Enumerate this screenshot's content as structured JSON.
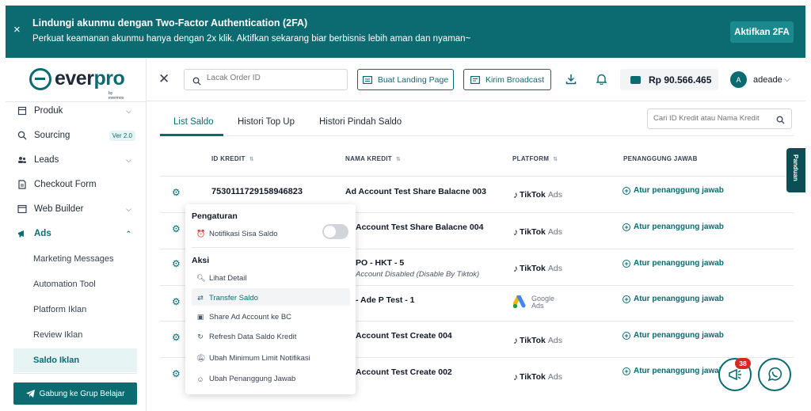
{
  "banner": {
    "title": "Lindungi akunmu dengan Two-Factor Authentication (2FA)",
    "description": "Perkuat keamanan akunmu hanya dengan 2x klik. Aktifkan sekarang biar berbisnis lebih aman dan nyaman~",
    "cta_label": "Aktifkan 2FA",
    "close_icon": "×"
  },
  "logo": {
    "text_ever": "ever",
    "text_pro": "pro",
    "by": "by evermos"
  },
  "sidebar": {
    "items": [
      {
        "label": "Produk"
      },
      {
        "label": "Sourcing",
        "badge": "Ver 2.0"
      },
      {
        "label": "Leads"
      },
      {
        "label": "Checkout Form"
      },
      {
        "label": "Web Builder"
      },
      {
        "label": "Ads"
      }
    ],
    "sub_items": [
      {
        "label": "Marketing Messages"
      },
      {
        "label": "Automation Tool"
      },
      {
        "label": "Platform Iklan"
      },
      {
        "label": "Review Iklan"
      },
      {
        "label": "Saldo Iklan"
      }
    ],
    "join_label": "Gabung ke Grup Belajar"
  },
  "header": {
    "search_placeholder": "Lacak Order ID",
    "btn_landing": "Buat Landing Page",
    "btn_broadcast": "Kirim Broadcast",
    "balance": "Rp 90.566.465",
    "avatar_initial": "A",
    "username": "adeade"
  },
  "tabs": [
    {
      "label": "List Saldo"
    },
    {
      "label": "Histori Top Up"
    },
    {
      "label": "Histori Pindah Saldo"
    }
  ],
  "table_search_placeholder": "Cari ID Kredit atau Nama Kredit",
  "table": {
    "columns": [
      "ID KREDIT",
      "NAMA KREDIT",
      "PLATFORM",
      "PENANGGUNG JAWAB"
    ],
    "rows": [
      {
        "id": "7530111729158946823",
        "name": "Ad Account Test Share Balacne 003",
        "sub": "",
        "platform": "TikTok",
        "action": "Atur penanggung jawab"
      },
      {
        "id": "",
        "name": "Account Test Share Balacne 004",
        "sub": "",
        "platform": "TikTok",
        "action": "Atur penanggung jawab"
      },
      {
        "id": "",
        "name": "PO - HKT - 5",
        "sub": "Account Disabled (Disable By Tiktok)",
        "platform": "TikTok",
        "action": "Atur penanggung jawab"
      },
      {
        "id": "",
        "name": "- Ade P Test - 1",
        "sub": "",
        "platform": "Google",
        "action": "Atur penanggung jawab"
      },
      {
        "id": "",
        "name": "Account Test Create 004",
        "sub": "",
        "platform": "TikTok",
        "action": "Atur penanggung jawab"
      },
      {
        "id": "",
        "name": "Account Test Create 002",
        "sub": "",
        "platform": "TikTok",
        "action": "Atur penanggung jawab"
      }
    ],
    "tiktok_brand": "TikTok",
    "tiktok_ads": "Ads",
    "google_brand": "Google",
    "google_ads": "Ads"
  },
  "popup": {
    "settings_title": "Pengaturan",
    "notif_label": "Notifikasi Sisa Saldo",
    "notif_enabled": false,
    "actions_title": "Aksi",
    "actions": [
      {
        "label": "Lihat Detail"
      },
      {
        "label": "Transfer Saldo"
      },
      {
        "label": "Share Ad Account ke BC"
      },
      {
        "label": "Refresh Data Saldo Kredit"
      },
      {
        "label": "Ubah Minimum Limit Notifikasi"
      },
      {
        "label": "Ubah Penanggung Jawab"
      }
    ]
  },
  "panduan_label": "Panduan",
  "fab_badge": "38",
  "colors": {
    "primary": "#0b6b71",
    "banner": "#0b6b71",
    "badge": "#dc2626"
  }
}
